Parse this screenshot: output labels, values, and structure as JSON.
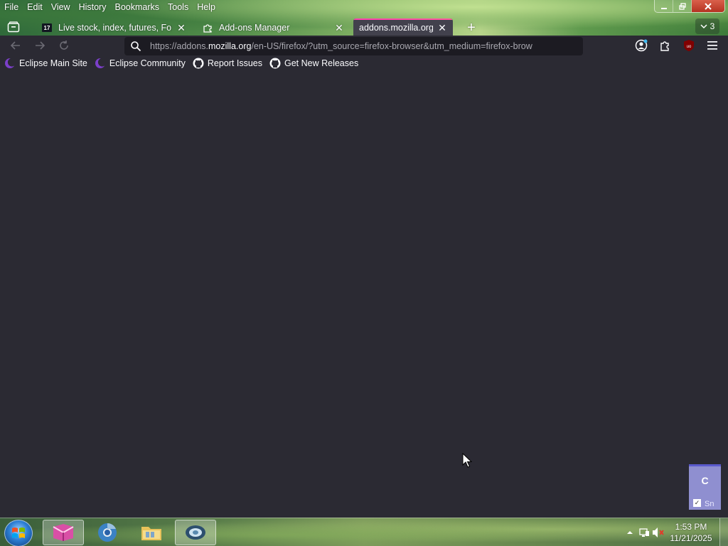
{
  "menubar": {
    "items": [
      "File",
      "Edit",
      "View",
      "History",
      "Bookmarks",
      "Tools",
      "Help"
    ]
  },
  "tabs": [
    {
      "title": "Live stock, index, futures, Forex",
      "favicon": "tradingview-icon",
      "selected": false
    },
    {
      "title": "Add-ons Manager",
      "favicon": "puzzle-piece-icon",
      "selected": false
    },
    {
      "title": "addons.mozilla.org/e",
      "favicon": "",
      "selected": true
    }
  ],
  "tab_overflow": {
    "count": "3"
  },
  "navbar": {
    "url_prefix": "https://addons.",
    "url_domain": "mozilla.org",
    "url_rest": "/en-US/firefox/?utm_source=firefox-browser&utm_medium=firefox-brow"
  },
  "bookmarks": [
    {
      "label": "Eclipse Main Site",
      "icon": "eclipse-icon"
    },
    {
      "label": "Eclipse Community",
      "icon": "eclipse-icon"
    },
    {
      "label": "Report Issues",
      "icon": "github-icon"
    },
    {
      "label": "Get New Releases",
      "icon": "github-icon"
    }
  ],
  "side_widget": {
    "letter": "C",
    "text": "Sn"
  },
  "taskbar": {
    "time": "1:53 PM",
    "date": "11/21/2025"
  },
  "colors": {
    "content_bg": "#2b2a33",
    "urlbar_bg": "#1c1b22",
    "tab_selected_bg": "#42414d",
    "tab_accent": "#ff3fb0"
  }
}
